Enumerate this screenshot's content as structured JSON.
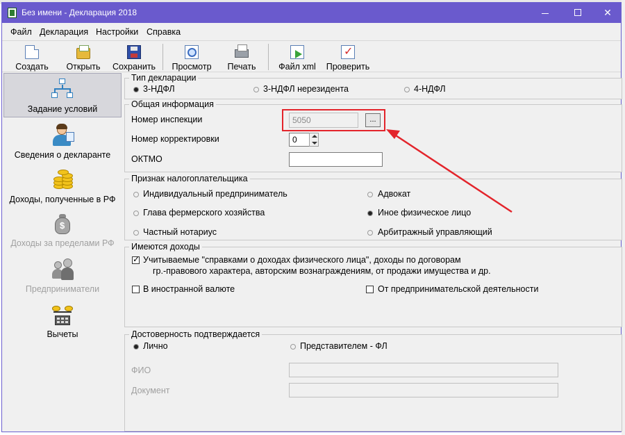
{
  "window": {
    "title": "Без имени - Декларация 2018",
    "controls": {
      "minimize": "—",
      "maximize": "☐",
      "close": "✕"
    }
  },
  "menu": [
    "Файл",
    "Декларация",
    "Настройки",
    "Справка"
  ],
  "toolbar": [
    {
      "label": "Создать",
      "icon": "new-document-icon"
    },
    {
      "label": "Открыть",
      "icon": "open-folder-icon"
    },
    {
      "label": "Сохранить",
      "icon": "save-floppy-icon"
    },
    {
      "label": "Просмотр",
      "icon": "preview-icon"
    },
    {
      "label": "Печать",
      "icon": "printer-icon"
    },
    {
      "label": "Файл xml",
      "icon": "export-xml-icon"
    },
    {
      "label": "Проверить",
      "icon": "check-icon"
    }
  ],
  "nav": [
    {
      "label": "Задание условий",
      "active": true,
      "enabled": true
    },
    {
      "label": "Сведения о декларанте",
      "active": false,
      "enabled": true
    },
    {
      "label": "Доходы, полученные в РФ",
      "active": false,
      "enabled": true
    },
    {
      "label": "Доходы за пределами РФ",
      "active": false,
      "enabled": false
    },
    {
      "label": "Предприниматели",
      "active": false,
      "enabled": false
    },
    {
      "label": "Вычеты",
      "active": false,
      "enabled": true
    }
  ],
  "declaration_type": {
    "title": "Тип декларации",
    "options": [
      "3-НДФЛ",
      "3-НДФЛ нерезидента",
      "4-НДФЛ"
    ],
    "selected": "3-НДФЛ"
  },
  "general_info": {
    "title": "Общая информация",
    "inspection_label": "Номер инспекции",
    "inspection_value": "5050",
    "inspection_button": "...",
    "correction_label": "Номер корректировки",
    "correction_value": "0",
    "oktmo_label": "ОКТМО",
    "oktmo_value": ""
  },
  "taxpayer": {
    "title": "Признак налогоплательщика",
    "options": [
      "Индивидуальный предприниматель",
      "Адвокат",
      "Глава фермерского хозяйства",
      "Иное физическое лицо",
      "Частный нотариус",
      "Арбитражный управляющий"
    ],
    "selected": "Иное физическое лицо"
  },
  "income": {
    "title": "Имеются доходы",
    "certified_line1": "Учитываемые \"справками о доходах физического лица\", доходы по договорам",
    "certified_line2": "гр.-правового характера, авторским вознаграждениям, от продажи имущества и др.",
    "certified_checked": true,
    "foreign_currency": "В иностранной валюте",
    "foreign_checked": false,
    "business": "От предпринимательской деятельности",
    "business_checked": false
  },
  "confirmation": {
    "title": "Достоверность подтверждается",
    "options": [
      "Лично",
      "Представителем - ФЛ"
    ],
    "selected": "Лично",
    "fio_label": "ФИО",
    "fio_value": "",
    "document_label": "Документ",
    "document_value": ""
  },
  "colors": {
    "titlebar": "#6a5acd",
    "annotation": "#e3242b"
  }
}
